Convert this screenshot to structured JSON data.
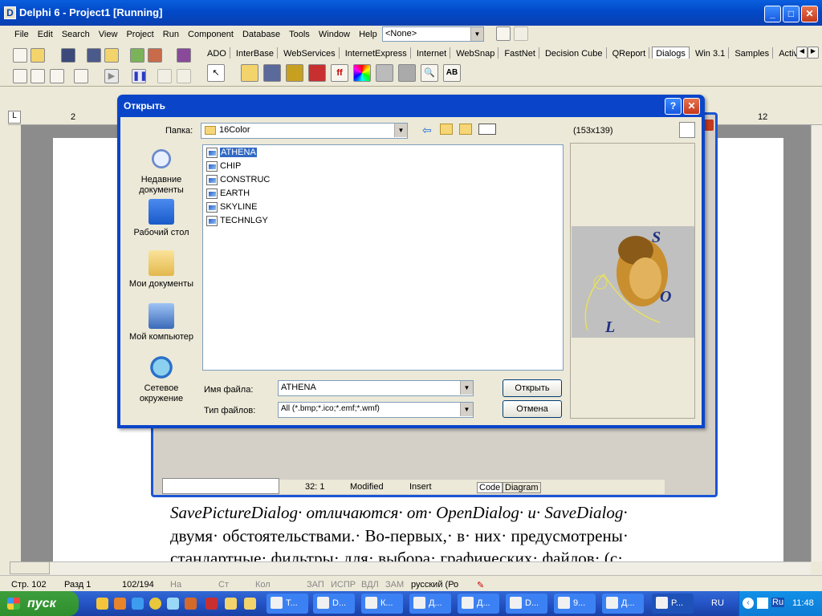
{
  "delphi": {
    "title": "Delphi 6 - Project1 [Running]",
    "menu": [
      "File",
      "Edit",
      "Search",
      "View",
      "Project",
      "Run",
      "Component",
      "Database",
      "Tools",
      "Window",
      "Help"
    ],
    "combo_value": "<None>",
    "palette_tabs": [
      "ADO",
      "InterBase",
      "WebServices",
      "InternetExpress",
      "Internet",
      "WebSnap",
      "FastNet",
      "Decision Cube",
      "QReport",
      "Dialogs",
      "Win 3.1",
      "Samples",
      "Active"
    ],
    "active_tab": "Dialogs"
  },
  "form_status": {
    "position": "32:   1",
    "state": "Modified",
    "mode": "Insert",
    "tab_code": "Code",
    "tab_diagram": "Diagram"
  },
  "dialog": {
    "title": "Открыть",
    "help_label": "?",
    "close_label": "✕",
    "folder_label": "Папка:",
    "folder_value": "16Color",
    "preview_size": "(153x139)",
    "places": [
      "Недавние документы",
      "Рабочий стол",
      "Мои документы",
      "Мой компьютер",
      "Сетевое окружение"
    ],
    "files": [
      "ATHENA",
      "CHIP",
      "CONSTRUC",
      "EARTH",
      "SKYLINE",
      "TECHNLGY"
    ],
    "selected_file": "ATHENA",
    "filename_label": "Имя файла:",
    "filename_value": "ATHENA",
    "filetype_label": "Тип файлов:",
    "filetype_value": "All (*.bmp;*.ico;*.emf;*.wmf)",
    "open_button": "Открыть",
    "cancel_button": "Отмена",
    "preview_letters": [
      "S",
      "O",
      "L"
    ]
  },
  "word": {
    "ruler_left": "2",
    "ruler_right": "12",
    "lines": [
      "SavePictureDialog· отличаются· от· OpenDialog· и· SaveDialog·",
      "двумя· обстоятельствами.· Во-первых,· в· них· предусмотрены·",
      "стандартные· фильтры· для· выбора· графических· файлов· (с·"
    ],
    "status": {
      "page": "Стр.  102",
      "section": "Разд  1",
      "count": "102/194",
      "at": "На",
      "line": "Ст",
      "col": "Кол",
      "rec": "ЗАП",
      "trk": "ИСПР",
      "ext": "ВДЛ",
      "ovr": "ЗАМ",
      "lang": "русский (Ро"
    }
  },
  "taskbar": {
    "start_label": "пуск",
    "tasks": [
      "Т...",
      "D...",
      "К...",
      "Д...",
      "Д...",
      "D...",
      "9...",
      "Д...",
      "P..."
    ],
    "lang": "RU",
    "time": "11:48",
    "kbd": "Ru"
  }
}
